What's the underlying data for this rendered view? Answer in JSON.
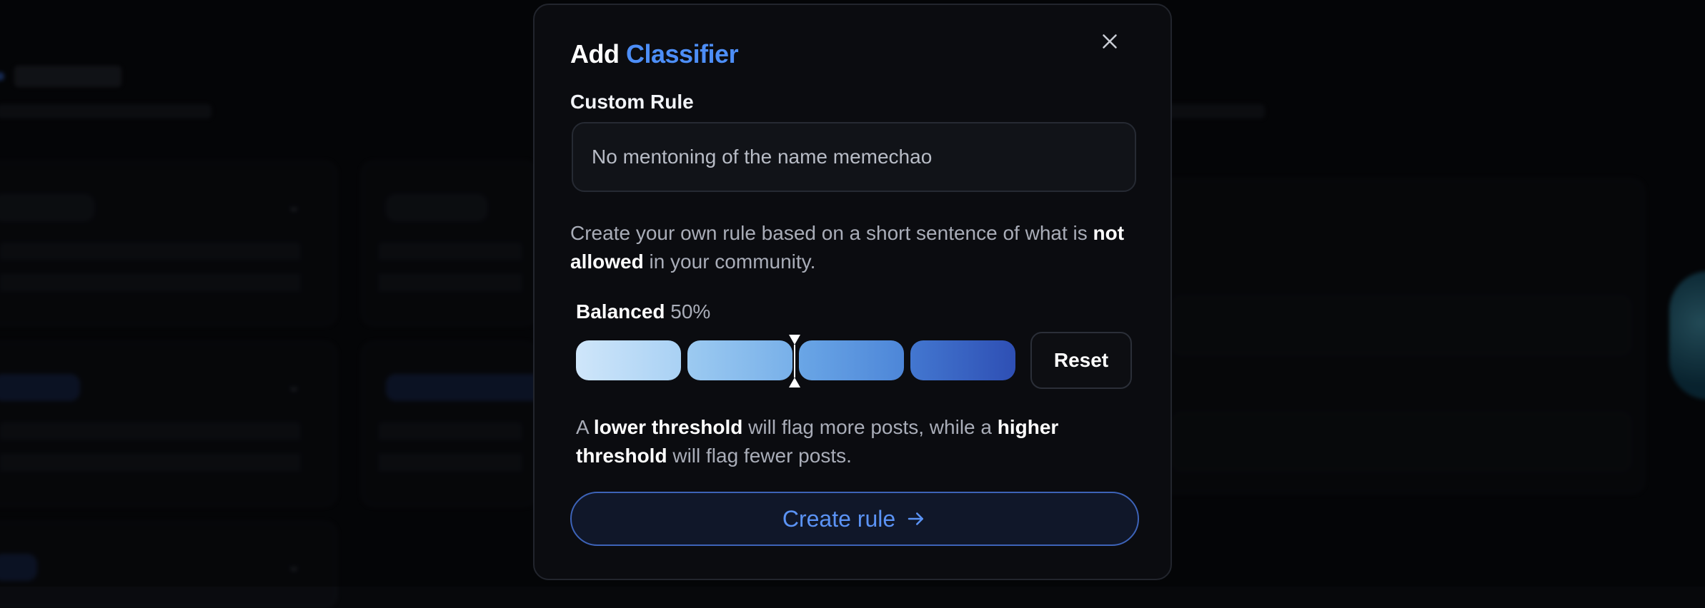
{
  "modal": {
    "title_prefix": "Add",
    "title_accent": "Classifier",
    "field_label": "Custom Rule",
    "rule_input_value": "No mentoning of the name memechao",
    "help_part1": "Create your own rule based on a short sentence of what is ",
    "help_bold": "not allowed",
    "help_part2": " in your community.",
    "threshold": {
      "level_label": "Balanced",
      "percent_label": "50%",
      "value": 0.5,
      "segments": 4,
      "reset_label": "Reset"
    },
    "hint": {
      "p1": "A ",
      "b1": "lower threshold",
      "p2": " will flag more posts, while a ",
      "b2": "higher threshold",
      "p3": " will flag fewer posts."
    },
    "create_label": "Create rule",
    "icons": {
      "close": "close-icon",
      "arrow": "arrow-right-icon"
    }
  },
  "colors": {
    "accent": "#4d8ef7",
    "background": "#07080b",
    "modal_bg": "#0b0c10",
    "segment_gradient": [
      "#cfe6fa",
      "#2e4fb4"
    ]
  }
}
